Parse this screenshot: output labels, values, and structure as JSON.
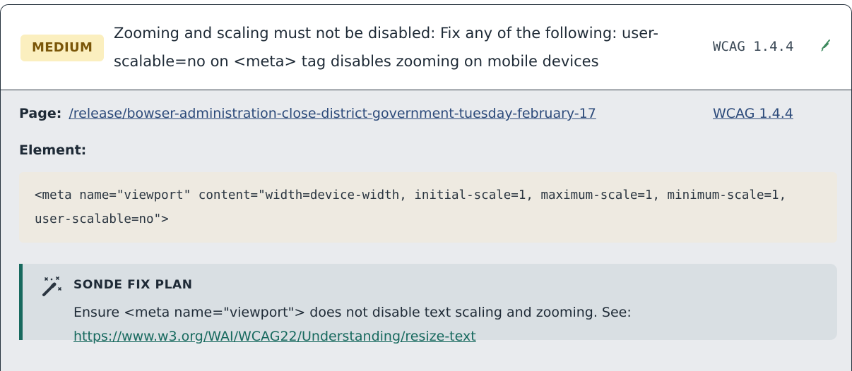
{
  "issue": {
    "severity": "MEDIUM",
    "title": "Zooming and scaling must not be disabled: Fix any of the following: user-scalable=no on <meta> tag disables zooming on mobile devices",
    "wcag_ref": "WCAG 1.4.4",
    "edit_icon": "edit-icon"
  },
  "details": {
    "page_label": "Page:",
    "page_url": "/release/bowser-administration-close-district-government-tuesday-february-17",
    "wcag_link": "WCAG 1.4.4",
    "element_label": "Element:",
    "element_code": "<meta name=\"viewport\" content=\"width=device-width, initial-scale=1, maximum-scale=1, minimum-scale=1, user-scalable=no\">"
  },
  "fix_plan": {
    "icon": "magic-wand-icon",
    "title": "SONDE FIX PLAN",
    "text": "Ensure <meta name=\"viewport\"> does not disable text scaling and zooming. See: ",
    "link": "https://www.w3.org/WAI/WCAG22/Understanding/resize-text"
  },
  "colors": {
    "badge_bg": "#fbefbf",
    "badge_text": "#7a5608",
    "accent": "#17695e",
    "link": "#2c4a7a"
  }
}
